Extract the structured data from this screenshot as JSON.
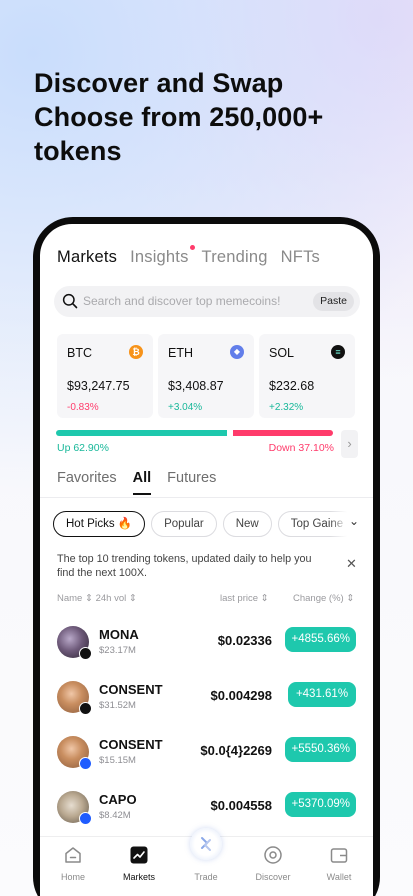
{
  "headline": [
    "Discover and Swap",
    "Choose from 250,000+",
    "tokens"
  ],
  "top_tabs": [
    "Markets",
    "Insights",
    "Trending",
    "NFTs"
  ],
  "search": {
    "placeholder": "Search and discover top memecoins!",
    "paste_label": "Paste"
  },
  "coins": [
    {
      "symbol": "BTC",
      "icon": "bitcoin-icon",
      "icon_char": "₿",
      "icon_color": "#f7931a",
      "price": "$93,247.75",
      "change": "-0.83%",
      "direction": "down"
    },
    {
      "symbol": "ETH",
      "icon": "ethereum-icon",
      "icon_char": "◆",
      "icon_color": "#627eea",
      "price": "$3,408.87",
      "change": "+3.04%",
      "direction": "up"
    },
    {
      "symbol": "SOL",
      "icon": "solana-icon",
      "icon_char": "≡",
      "icon_color": "#111111",
      "price": "$232.68",
      "change": "+2.32%",
      "direction": "up"
    }
  ],
  "sentiment": {
    "up_label": "Up 62.90%",
    "down_label": "Down 37.10%",
    "up_fraction": 0.629
  },
  "sub_tabs": [
    "Favorites",
    "All",
    "Futures"
  ],
  "chips": [
    "Hot Picks 🔥",
    "Popular",
    "New",
    "Top Gaine"
  ],
  "info_text": "The top 10 trending tokens, updated daily to help you find the next 100X.",
  "columns": {
    "name": "Name ⇕ 24h vol ⇕",
    "price": "last price ⇕",
    "change": "Change (%) ⇕"
  },
  "tokens": [
    {
      "name": "MONA",
      "volume": "$23.17M",
      "price": "$0.02336",
      "change": "+4855.66%",
      "chain": "solana"
    },
    {
      "name": "CONSENT",
      "volume": "$31.52M",
      "price": "$0.004298",
      "change": "+431.61%",
      "chain": "solana"
    },
    {
      "name": "CONSENT",
      "volume": "$15.15M",
      "price": "$0.0{4}2269",
      "change": "+5550.36%",
      "chain": "base"
    },
    {
      "name": "CAPO",
      "volume": "$8.42M",
      "price": "$0.004558",
      "change": "+5370.09%",
      "chain": "base"
    }
  ],
  "nav": [
    "Home",
    "Markets",
    "Trade",
    "Discover",
    "Wallet"
  ],
  "colors": {
    "accent_green": "#1ec8ad",
    "accent_red": "#ff3b6b"
  }
}
